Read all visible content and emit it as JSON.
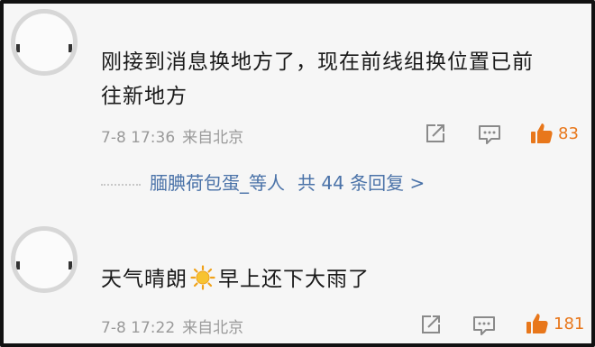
{
  "comments": [
    {
      "text_line1": "刚接到消息换地方了，现在前线组换位置已前",
      "text_line2": "往新地方",
      "time": "7-8 17:36",
      "location": "来自北京",
      "likes": "83",
      "replies": {
        "users": "腼腆荷包蛋_等人",
        "total": "共 44 条回复 >"
      }
    },
    {
      "text_before": "天气晴朗",
      "text_after": "早上还下大雨了",
      "emoji": "sun-emoji",
      "time": "7-8 17:22",
      "location": "来自北京",
      "likes": "181"
    }
  ],
  "icons": {
    "share": "share-icon",
    "comment": "comment-icon",
    "like": "thumbs-up-icon"
  },
  "colors": {
    "like": "#e8771b",
    "link": "#4a72a8",
    "meta": "#9a9a9a"
  }
}
